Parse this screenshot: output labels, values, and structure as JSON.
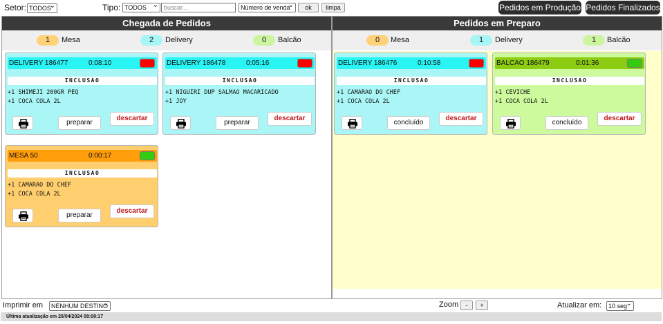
{
  "filters": {
    "setor_label": "Setor:",
    "setor_value": "TODOS",
    "tipo_label": "Tipo:",
    "tipo_value": "TODOS",
    "search_placeholder": "buscar...",
    "search_field_value": "Número de venda",
    "ok_label": "ok",
    "limpa_label": "limpa"
  },
  "nav": {
    "producao_label": "Pedidos em Produção",
    "finalizados_label": "Pedidos Finalizados"
  },
  "left_panel": {
    "title": "Chegada de Pedidos",
    "counts": [
      {
        "count": "1",
        "label": "Mesa",
        "color": "#ffd27a"
      },
      {
        "count": "2",
        "label": "Delivery",
        "color": "#a8f5f5"
      },
      {
        "count": "0",
        "label": "Balcão",
        "color": "#cdf5a0"
      }
    ],
    "cards": [
      {
        "name": "DELIVERY 186477",
        "time": "0:08:10",
        "light": "red",
        "header_color": "#2af5f5",
        "bg_color": "#aaf6f6",
        "section": "INCLUSAO",
        "items": [
          "+1 SHIMEJI 200GR PEQ",
          "+1 COCA COLA 2L"
        ],
        "action": "preparar",
        "discard": "descartar"
      },
      {
        "name": "DELIVERY 186478",
        "time": "0:05:16",
        "light": "red",
        "header_color": "#2af5f5",
        "bg_color": "#aaf6f6",
        "section": "INCLUSAO",
        "items": [
          "+1 NIGUIRI DUP SALMAO MACARICADO",
          "+1 JOY"
        ],
        "action": "preparar",
        "discard": "descartar"
      },
      {
        "name": "MESA 50",
        "time": "0:00:17",
        "light": "green",
        "header_color": "#ff9d0a",
        "bg_color": "#ffcf6f",
        "section": "INCLUSAO",
        "items": [
          "+1 CAMARAO DO CHEF",
          "+1 COCA COLA 2L"
        ],
        "action": "preparar",
        "discard": "descartar"
      }
    ]
  },
  "right_panel": {
    "title": "Pedidos em Preparo",
    "counts": [
      {
        "count": "0",
        "label": "Mesa",
        "color": "#ffd27a"
      },
      {
        "count": "1",
        "label": "Delivery",
        "color": "#a8f5f5"
      },
      {
        "count": "1",
        "label": "Balcão",
        "color": "#cdf5a0"
      }
    ],
    "bg_color": "#ffffcc",
    "cards": [
      {
        "name": "DELIVERY 186476",
        "time": "0:10:58",
        "light": "red",
        "header_color": "#2af5f5",
        "bg_color": "#aaf6f6",
        "section": "INCLUSAO",
        "items": [
          "+1 CAMARAO DO CHEF",
          "+1 COCA COLA 2L"
        ],
        "action": "concluído",
        "discard": "descartar"
      },
      {
        "name": "BALCAO 186479",
        "time": "0:01:36",
        "light": "green",
        "header_color": "#8ccc12",
        "bg_color": "#ccfa9d",
        "section": "INCLUSAO",
        "items": [
          "+1 CEVICHE",
          "+1 COCA COLA 2L"
        ],
        "action": "concluído",
        "discard": "descartar"
      }
    ]
  },
  "footer": {
    "imprimir_label": "Imprimir em",
    "imprimir_value": "NENHUM DESTINO",
    "zoom_label": "Zoom",
    "zoom_minus": "-",
    "zoom_plus": "+",
    "atualizar_label": "Atualizar em:",
    "atualizar_value": "10 seg",
    "last_update": "Última atualização em 26/04/2024 08:08:17"
  },
  "colors": {
    "light_red": "#ff0000",
    "light_green": "#33cc11",
    "discard_text": "#c0171d"
  }
}
